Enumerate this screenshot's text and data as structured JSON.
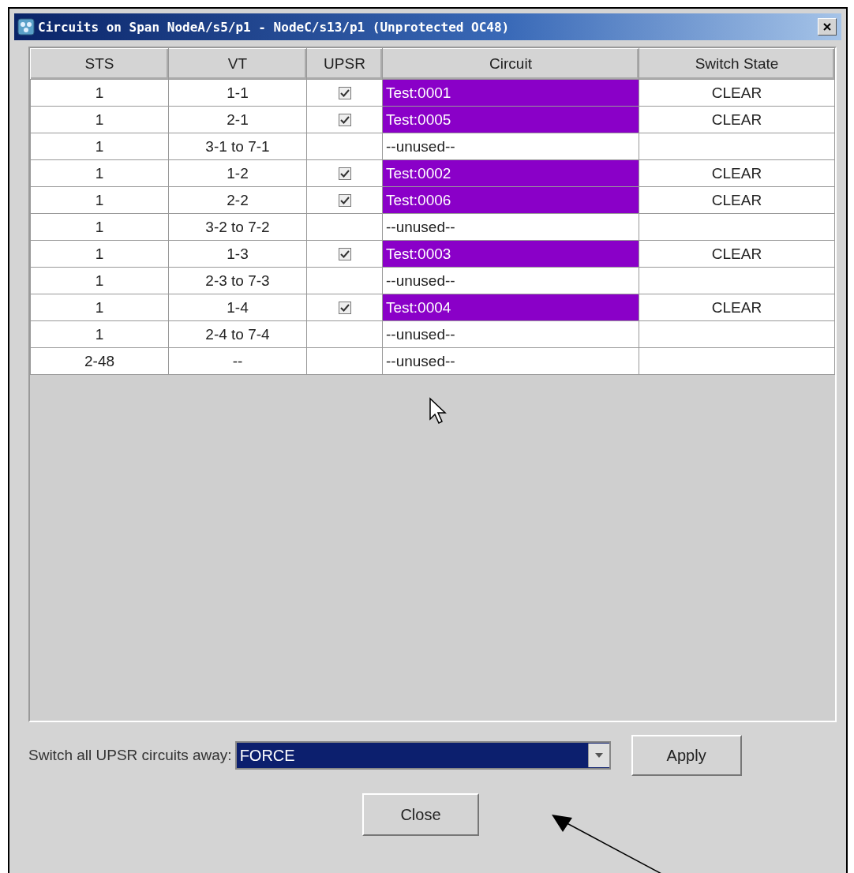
{
  "window": {
    "title": "Circuits on Span NodeA/s5/p1 - NodeC/s13/p1 (Unprotected OC48)"
  },
  "table": {
    "columns": [
      "STS",
      "VT",
      "UPSR",
      "Circuit",
      "Switch State"
    ],
    "rows": [
      {
        "sts": "1",
        "vt": "1-1",
        "upsr": true,
        "circuit": "Test:0001",
        "highlighted": true,
        "switch_state": "CLEAR"
      },
      {
        "sts": "1",
        "vt": "2-1",
        "upsr": true,
        "circuit": "Test:0005",
        "highlighted": true,
        "switch_state": "CLEAR"
      },
      {
        "sts": "1",
        "vt": "3-1 to 7-1",
        "upsr": false,
        "circuit": "--unused--",
        "highlighted": false
      },
      {
        "sts": "1",
        "vt": "1-2",
        "upsr": true,
        "circuit": "Test:0002",
        "highlighted": true,
        "switch_state": "CLEAR"
      },
      {
        "sts": "1",
        "vt": "2-2",
        "upsr": true,
        "circuit": "Test:0006",
        "highlighted": true,
        "switch_state": "CLEAR"
      },
      {
        "sts": "1",
        "vt": "3-2 to 7-2",
        "upsr": false,
        "circuit": "--unused--",
        "highlighted": false
      },
      {
        "sts": "1",
        "vt": "1-3",
        "upsr": true,
        "circuit": "Test:0003",
        "highlighted": true,
        "switch_state": "CLEAR"
      },
      {
        "sts": "1",
        "vt": "2-3 to 7-3",
        "upsr": false,
        "circuit": "--unused--",
        "highlighted": false
      },
      {
        "sts": "1",
        "vt": "1-4",
        "upsr": true,
        "circuit": "Test:0004",
        "highlighted": true,
        "switch_state": "CLEAR"
      },
      {
        "sts": "1",
        "vt": "2-4 to 7-4",
        "upsr": false,
        "circuit": "--unused--",
        "highlighted": false
      },
      {
        "sts": "2-48",
        "vt": "--",
        "upsr": false,
        "circuit": "--unused--",
        "highlighted": false
      }
    ]
  },
  "switch_control": {
    "label": "Switch all UPSR circuits away:",
    "value": "FORCE"
  },
  "buttons": {
    "apply": "Apply",
    "close": "Close"
  }
}
